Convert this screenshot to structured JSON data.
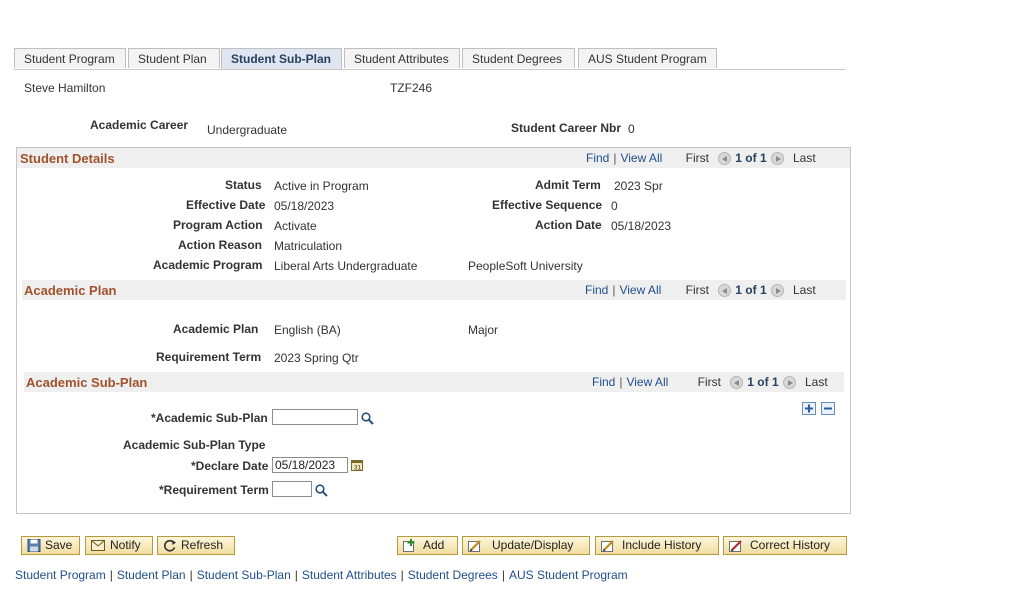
{
  "tabs": [
    {
      "label": "Student Program"
    },
    {
      "label": "Student Plan"
    },
    {
      "label": "Student Sub-Plan"
    },
    {
      "label": "Student Attributes"
    },
    {
      "label": "Student Degrees"
    },
    {
      "label": "AUS Student Program"
    }
  ],
  "header": {
    "name": "Steve Hamilton",
    "id": "TZF246",
    "academic_career_label": "Academic Career",
    "academic_career_value": "Undergraduate",
    "career_nbr_label": "Student Career Nbr",
    "career_nbr_value": "0"
  },
  "nav": {
    "find": "Find",
    "view_all": "View All",
    "first": "First",
    "count": "1 of 1",
    "last": "Last"
  },
  "student_details": {
    "title": "Student Details",
    "status_label": "Status",
    "status_value": "Active in Program",
    "admit_term_label": "Admit Term",
    "admit_term_value": "2023 Spr",
    "effective_date_label": "Effective Date",
    "effective_date_value": "05/18/2023",
    "effective_sequence_label": "Effective Sequence",
    "effective_sequence_value": "0",
    "program_action_label": "Program Action",
    "program_action_value": "Activate",
    "action_date_label": "Action Date",
    "action_date_value": "05/18/2023",
    "action_reason_label": "Action Reason",
    "action_reason_value": "Matriculation",
    "academic_program_label": "Academic Program",
    "academic_program_value": "Liberal Arts Undergraduate",
    "institution_value": "PeopleSoft University"
  },
  "academic_plan": {
    "title": "Academic Plan",
    "plan_label": "Academic Plan",
    "plan_value": "English (BA)",
    "plan_type_value": "Major",
    "requirement_term_label": "Requirement Term",
    "requirement_term_value": "2023 Spring Qtr"
  },
  "academic_sub_plan": {
    "title": "Academic Sub-Plan",
    "sub_plan_label": "*Academic Sub-Plan",
    "sub_plan_value": "",
    "sub_plan_type_label": "Academic Sub-Plan Type",
    "declare_date_label": "*Declare Date",
    "declare_date_value": "05/18/2023",
    "requirement_term_label": "*Requirement Term",
    "requirement_term_value": "",
    "add_symbol": "+",
    "remove_symbol": "−"
  },
  "buttons": {
    "save": "Save",
    "notify": "Notify",
    "refresh": "Refresh",
    "add": "Add",
    "update_display": "Update/Display",
    "include_history": "Include History",
    "correct_history": "Correct History"
  },
  "footer_links": [
    {
      "label": "Student Program"
    },
    {
      "label": "Student Plan"
    },
    {
      "label": "Student Sub-Plan"
    },
    {
      "label": "Student Attributes"
    },
    {
      "label": "Student Degrees"
    },
    {
      "label": "AUS Student Program"
    }
  ],
  "colors": {
    "section_title": "#a0522d",
    "link": "#1f4e8c",
    "button_border": "#b89a3e"
  }
}
